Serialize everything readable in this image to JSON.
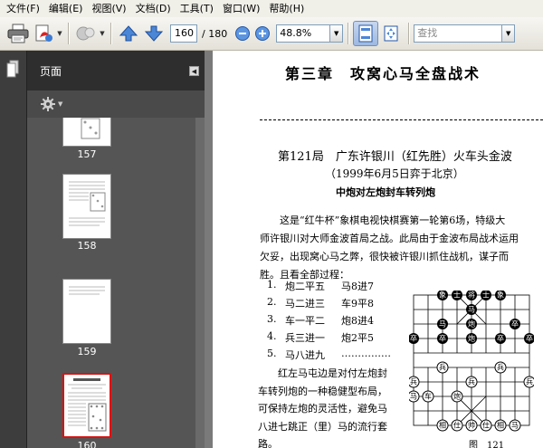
{
  "menu": [
    "文件(F)",
    "编辑(E)",
    "视图(V)",
    "文档(D)",
    "工具(T)",
    "窗口(W)",
    "帮助(H)"
  ],
  "toolbar": {
    "icons": [
      "printer-icon",
      "create-pdf-icon",
      "collaborate-icon",
      "previous-page-icon",
      "next-page-icon",
      "zoom-out-icon",
      "zoom-in-icon",
      "fit-page-icon",
      "fit-width-icon"
    ],
    "current_page": "160",
    "total_pages": "/ 180",
    "zoom": "48.8%",
    "search_placeholder": "查找"
  },
  "sidebar": {
    "title": "页面",
    "thumbnails": [
      {
        "label": "157"
      },
      {
        "label": "158"
      },
      {
        "label": "159"
      },
      {
        "label": "160",
        "selected": true
      }
    ]
  },
  "document": {
    "chapter_title": "第三章　攻窝心马全盘战术",
    "game_title": "第121局　广东许银川（红先胜）火车头金波",
    "game_date": "（1999年6月5日弈于北京）",
    "opening": "中炮对左炮封车转列炮",
    "paragraph": [
      "　　这是“红牛杯”象棋电视快棋赛第一轮第6场，特级大",
      "师许银川对大师金波首局之战。此局由于金波布局战术运用",
      "欠妥，出现窝心马之弊，很快被许银川抓住战机，谋子而",
      "胜。且看全部过程："
    ],
    "moves": [
      {
        "n": "1.",
        "red": "炮二平五",
        "black": "马8进7"
      },
      {
        "n": "2.",
        "red": "马二进三",
        "black": "车9平8"
      },
      {
        "n": "3.",
        "red": "车一平二",
        "black": "炮8进4"
      },
      {
        "n": "4.",
        "red": "兵三进一",
        "black": "炮2平5"
      },
      {
        "n": "5.",
        "red": "马八进九",
        "black": "……………"
      }
    ],
    "side_paragraph": [
      "　　红左马屯边是对付左炮封",
      "车转列炮的一种稳健型布局，",
      "可保持左炮的灵活性，避免马",
      "八进七跳正（里）马的流行套",
      "路。"
    ],
    "figure_caption": "图　121",
    "board_pieces": {
      "top_row": [
        "象",
        "士",
        "将",
        "士",
        "象"
      ],
      "upper": [
        "马",
        "马"
      ],
      "mid1": [
        "炮",
        "卒"
      ],
      "mid2": [
        "卒",
        "卒",
        "炮",
        "卒",
        "卒"
      ],
      "lower1": [
        "兵",
        "兵"
      ],
      "lower2": [
        "兵",
        "兵",
        "兵"
      ],
      "lower3": [
        "马",
        "车",
        "炮"
      ],
      "bottom_row": [
        "相",
        "仕",
        "帅",
        "仕",
        "相",
        "马"
      ]
    }
  }
}
